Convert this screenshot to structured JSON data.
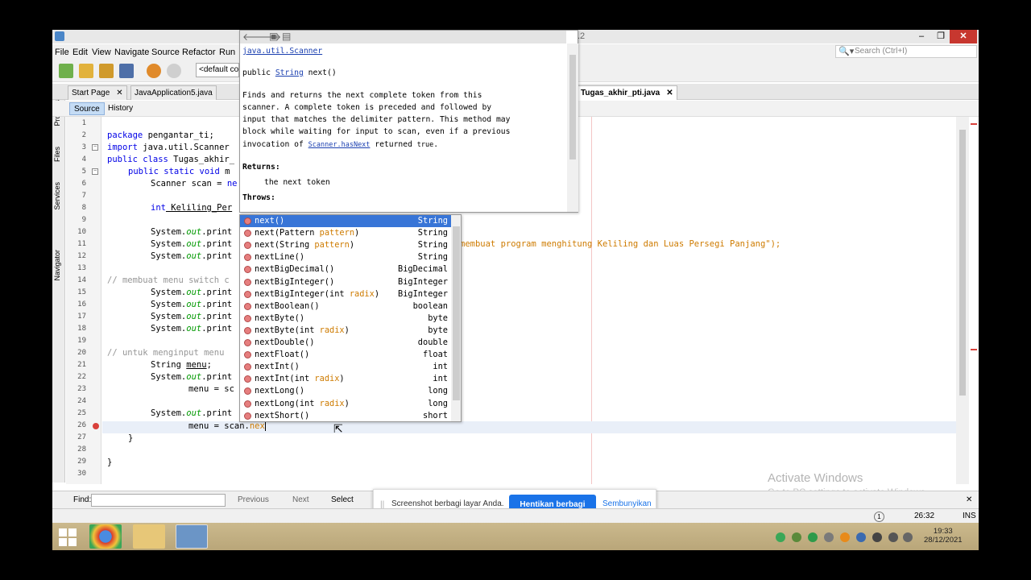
{
  "window": {
    "title_suffix": ".2",
    "controls": {
      "minimize": "–",
      "maximize": "❐",
      "close": "✕"
    }
  },
  "menu": [
    "File",
    "Edit",
    "View",
    "Navigate",
    "Source",
    "Refactor",
    "Run"
  ],
  "search": {
    "placeholder": "Search (Ctrl+I)"
  },
  "toolbar": {
    "config": "<default con"
  },
  "tabs": [
    {
      "label": "Start Page"
    },
    {
      "label": "JavaApplication5.java"
    },
    {
      "label": "Tugas_akhir_pti.java"
    }
  ],
  "editor_toolbar": {
    "source": "Source",
    "history": "History"
  },
  "side_tabs": [
    "Projects",
    "Files",
    "Services",
    "Navigator"
  ],
  "line_numbers": [
    "1",
    "2",
    "3",
    "4",
    "5",
    "6",
    "7",
    "8",
    "9",
    "10",
    "11",
    "12",
    "13",
    "14",
    "15",
    "16",
    "17",
    "18",
    "19",
    "20",
    "21",
    "22",
    "23",
    "24",
    "25",
    "26",
    "27",
    "28",
    "29",
    "30"
  ],
  "code": {
    "l2a": "package",
    "l2b": " pengantar_ti;",
    "l3a": "import",
    "l3b": " java.util.Scanner",
    "l4a": "public class",
    "l4b": " Tugas_akhir_",
    "l5a": "public static void",
    "l5b": " m",
    "l6a": "Scanner scan = ",
    "l6b": "ne",
    "l8a": "int",
    "l8b": " Keliling_Per",
    "l10a": "System.",
    "l10b": "out",
    "l10c": ".print",
    "l11_string": "membuat program menghitung Keliling dan Luas Persegi Panjang\");",
    "l14": "// membuat menu switch c",
    "l20": "// untuk menginput menu",
    "l21a": "String ",
    "l21b": "menu",
    "l21c": ";",
    "l23": "menu = sc",
    "l26a": "menu = scan.",
    "l26b": "nex",
    "l27": "}",
    "l29": "}"
  },
  "javadoc": {
    "class": "java.util.Scanner",
    "sig_pre": "public ",
    "sig_type": "String",
    "sig_post": " next()",
    "desc1": "Finds and returns the next complete token from this",
    "desc2": "scanner. A complete token is preceded and followed by",
    "desc3": "input that matches the delimiter pattern. This method may",
    "desc4": "block while waiting for input to scan, even if a previous",
    "desc5a": "invocation of ",
    "desc5b": "Scanner.hasNext",
    "desc5c": " returned ",
    "desc5d": "true",
    "desc5e": ".",
    "returns_label": "Returns:",
    "returns_value": "the next token",
    "throws_label": "Throws:"
  },
  "completions": [
    {
      "name": "next",
      "params": [],
      "type": "String",
      "selected": true
    },
    {
      "name": "next",
      "params": [
        "Pattern ",
        "pattern"
      ],
      "type": "String"
    },
    {
      "name": "next",
      "params": [
        "String ",
        "pattern"
      ],
      "type": "String"
    },
    {
      "name": "nextLine",
      "params": [],
      "type": "String"
    },
    {
      "name": "nextBigDecimal",
      "params": [],
      "type": "BigDecimal"
    },
    {
      "name": "nextBigInteger",
      "params": [],
      "type": "BigInteger"
    },
    {
      "name": "nextBigInteger",
      "params": [
        "int ",
        "radix"
      ],
      "type": "BigInteger"
    },
    {
      "name": "nextBoolean",
      "params": [],
      "type": "boolean"
    },
    {
      "name": "nextByte",
      "params": [],
      "type": "byte"
    },
    {
      "name": "nextByte",
      "params": [
        "int ",
        "radix"
      ],
      "type": "byte"
    },
    {
      "name": "nextDouble",
      "params": [],
      "type": "double"
    },
    {
      "name": "nextFloat",
      "params": [],
      "type": "float"
    },
    {
      "name": "nextInt",
      "params": [],
      "type": "int"
    },
    {
      "name": "nextInt",
      "params": [
        "int ",
        "radix"
      ],
      "type": "int"
    },
    {
      "name": "nextLong",
      "params": [],
      "type": "long"
    },
    {
      "name": "nextLong",
      "params": [
        "int ",
        "radix"
      ],
      "type": "long"
    },
    {
      "name": "nextShort",
      "params": [],
      "type": "short"
    }
  ],
  "findbar": {
    "label": "Find:",
    "previous": "Previous",
    "next": "Next",
    "select": "Select"
  },
  "statusbar": {
    "position": "26:32",
    "mode": "INS",
    "notif_icon": "1"
  },
  "share_banner": {
    "message": "Screenshot berbagi layar Anda.",
    "stop": "Hentikan berbagi",
    "hide": "Sembunyikan"
  },
  "activation": {
    "title": "Activate Windows",
    "subtitle": "Go to PC settings to activate Windows."
  },
  "taskbar": {
    "time": "19:33",
    "date": "28/12/2021"
  },
  "colors": {
    "keyword": "#0000e6",
    "comment": "#969696",
    "string": "#ce7b00",
    "selection": "#3875d7",
    "share_button": "#1a73e8"
  }
}
